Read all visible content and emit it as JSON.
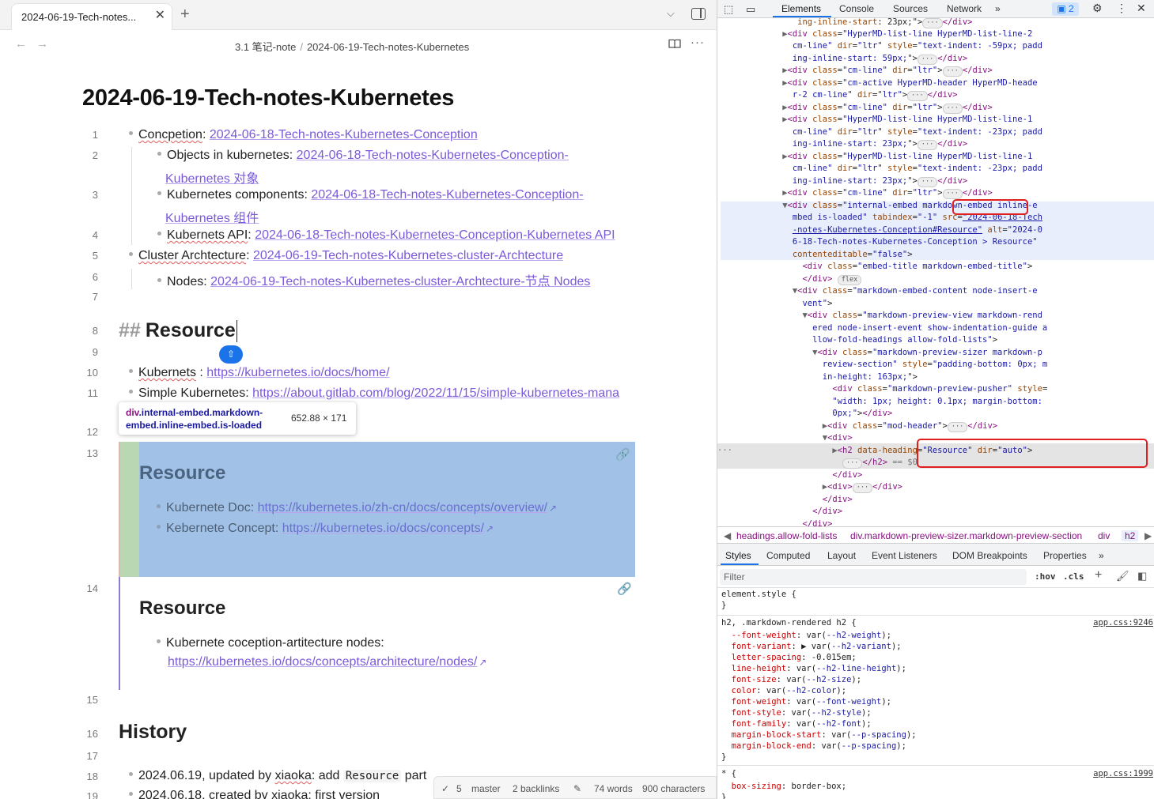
{
  "tab": {
    "title": "2024-06-19-Tech-notes...",
    "close": "✕",
    "new": "+"
  },
  "breadcrumb": {
    "folder": "3.1 笔记-note",
    "sep": "/",
    "note": "2024-06-19-Tech-notes-Kubernetes"
  },
  "page_title": "2024-06-19-Tech-notes-Kubernetes",
  "lines": [
    {
      "n": "1",
      "label": "Concpetion",
      "sep": ": ",
      "link": "2024-06-18-Tech-notes-Kubernetes-Conception"
    },
    {
      "n": "2",
      "label": "Objects in kubernetes",
      "sep": ": ",
      "link": "2024-06-18-Tech-notes-Kubernetes-Conception-",
      "link2": "Kubernetes 对象"
    },
    {
      "n": "3",
      "label": "Kubernetes components",
      "sep": ": ",
      "link": "2024-06-18-Tech-notes-Kubernetes-Conception-",
      "link2": "Kubernetes 组件"
    },
    {
      "n": "4",
      "label": "Kubernets API",
      "sep": ": ",
      "link": "2024-06-18-Tech-notes-Kubernetes-Conception-Kubernetes API"
    },
    {
      "n": "5",
      "label": "Cluster Archtecture",
      "sep": ": ",
      "link": "2024-06-19-Tech-notes-Kubernetes-cluster-Archtecture"
    },
    {
      "n": "6",
      "label": "Nodes",
      "sep": ": ",
      "link": "2024-06-19-Tech-notes-Kubernetes-cluster-Archtecture-节点 Nodes"
    },
    {
      "n": "7"
    },
    {
      "n": "8",
      "hash": "##",
      "heading": "Resource"
    },
    {
      "n": "9"
    },
    {
      "n": "10",
      "label": "Kubernets",
      "sep": " : ",
      "link": "https://kubernetes.io/docs/home/"
    },
    {
      "n": "11",
      "label": "Simple Kubernetes",
      "sep": ": ",
      "link": "https://about.gitlab.com/blog/2022/11/15/simple-kubernetes-mana"
    },
    {
      "n": "12"
    },
    {
      "n": "13"
    },
    {
      "n": "14"
    },
    {
      "n": "15"
    },
    {
      "n": "16",
      "heading": "History"
    },
    {
      "n": "17"
    },
    {
      "n": "18",
      "pre": "2024.06.19, updated by ",
      "user": "xiaoka",
      "mid": ": add ",
      "code": "Resource",
      "post": " part"
    },
    {
      "n": "19",
      "pre": "2024.06.18, created by ",
      "user": "xiaoka",
      "post": ": first version"
    }
  ],
  "fold_badge": "⇧",
  "tooltip": {
    "tag": "div",
    "classes": ".internal-embed.markdown-embed.inline-embed.is-loaded",
    "size": "652.88 × 171"
  },
  "embed1": {
    "title": "Resource",
    "items": [
      {
        "label": "Kubernete Doc: ",
        "link": "https://kubernetes.io/zh-cn/docs/concepts/overview/"
      },
      {
        "label": "Kebernete Concept: ",
        "link": "https://kubernetes.io/docs/concepts/"
      }
    ]
  },
  "embed2": {
    "title": "Resource",
    "items": [
      {
        "label": "Kubernete coception-artitecture nodes:",
        "link": "https://kubernetes.io/docs/concepts/architecture/nodes/"
      }
    ]
  },
  "status": {
    "sync": "✓",
    "count": "5",
    "branch": "master",
    "backlinks": "2 backlinks",
    "words": "74 words",
    "chars": "900 characters"
  },
  "devtools": {
    "tabs": [
      "Elements",
      "Console",
      "Sources",
      "Network",
      "»"
    ],
    "issues": "2",
    "sub_tabs": [
      "Styles",
      "Computed",
      "Layout",
      "Event Listeners",
      "DOM Breakpoints",
      "Properties",
      "»"
    ],
    "crumbs": [
      "headings.allow-fold-lists",
      "div.markdown-preview-sizer.markdown-preview-section",
      "div",
      "h2"
    ],
    "filter_placeholder": "Filter",
    "hov": ":hov",
    "cls": ".cls",
    "sources": [
      "app.css:9246",
      "app.css:1999"
    ]
  },
  "colors": {
    "accent": "#1a73e8",
    "link": "#7b59d9",
    "highlight": "#a1c1e6",
    "padding_hl": "#b9d7b3",
    "red_box": "#e02020"
  }
}
